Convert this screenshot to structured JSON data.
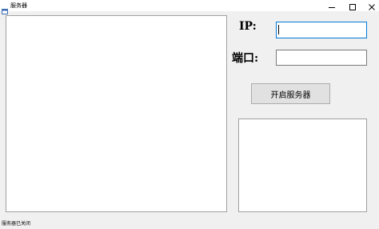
{
  "window": {
    "title": "服务器",
    "icon": "app-window-icon",
    "controls": {
      "minimize_icon": "minimize-icon",
      "maximize_icon": "maximize-icon",
      "close_icon": "close-icon"
    }
  },
  "form": {
    "ip_label": "IP:",
    "ip_value": "",
    "port_label": "端口:",
    "port_value": ""
  },
  "start_button_label": "开启服务器",
  "status": {
    "text": "服务器已关闭"
  },
  "colors": {
    "window_bg": "#f0f0f0",
    "focus_border": "#0078d7",
    "button_bg": "#e1e1e1"
  }
}
